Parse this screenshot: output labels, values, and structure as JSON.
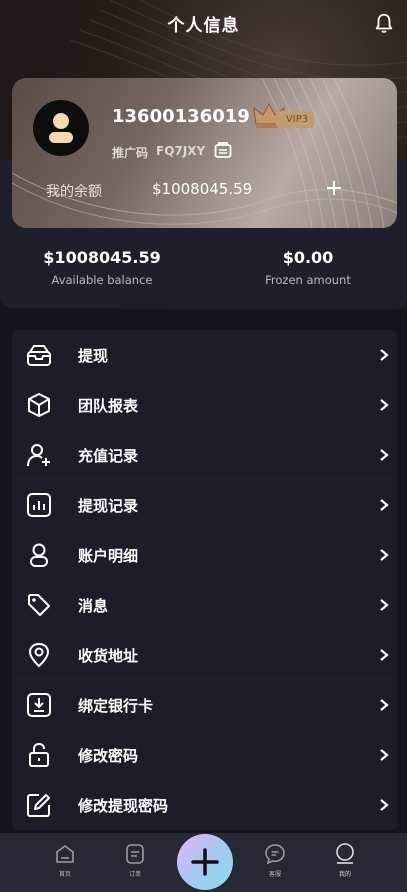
{
  "header": {
    "title": "个人信息",
    "bell_icon": "bell-icon"
  },
  "profile": {
    "phone": "13600136019",
    "vip_label": "VIP3",
    "referral_label": "推广码",
    "referral_code": "FQ7JXY",
    "balance_label": "我的余额",
    "balance_value": "$1008045.59"
  },
  "stats": {
    "available_value": "$1008045.59",
    "available_label": "Available balance",
    "frozen_value": "$0.00",
    "frozen_label": "Frozen amount"
  },
  "menu": [
    {
      "label": "提现",
      "icon": "withdraw-inbox-icon"
    },
    {
      "label": "团队报表",
      "icon": "cube-icon"
    },
    {
      "label": "充值记录",
      "icon": "add-user-icon"
    },
    {
      "label": "提现记录",
      "icon": "bar-chart-icon"
    },
    {
      "label": "账户明细",
      "icon": "user-icon"
    },
    {
      "label": "消息",
      "icon": "tag-icon"
    },
    {
      "label": "收货地址",
      "icon": "location-pin-icon"
    },
    {
      "label": "绑定银行卡",
      "icon": "download-box-icon"
    },
    {
      "label": "修改密码",
      "icon": "lock-icon"
    },
    {
      "label": "修改提现密码",
      "icon": "edit-icon"
    }
  ],
  "tabbar": [
    {
      "label": "首页",
      "icon": "home-icon"
    },
    {
      "label": "订单",
      "icon": "order-icon"
    },
    {
      "label": "",
      "icon": "plus-icon"
    },
    {
      "label": "客服",
      "icon": "chat-icon"
    },
    {
      "label": "我的",
      "icon": "profile-icon"
    }
  ],
  "colors": {
    "background": "#14151c",
    "menu_bg": "#1c1d29",
    "tabbar_bg": "#262835",
    "vip_gold": "#c29a74"
  }
}
